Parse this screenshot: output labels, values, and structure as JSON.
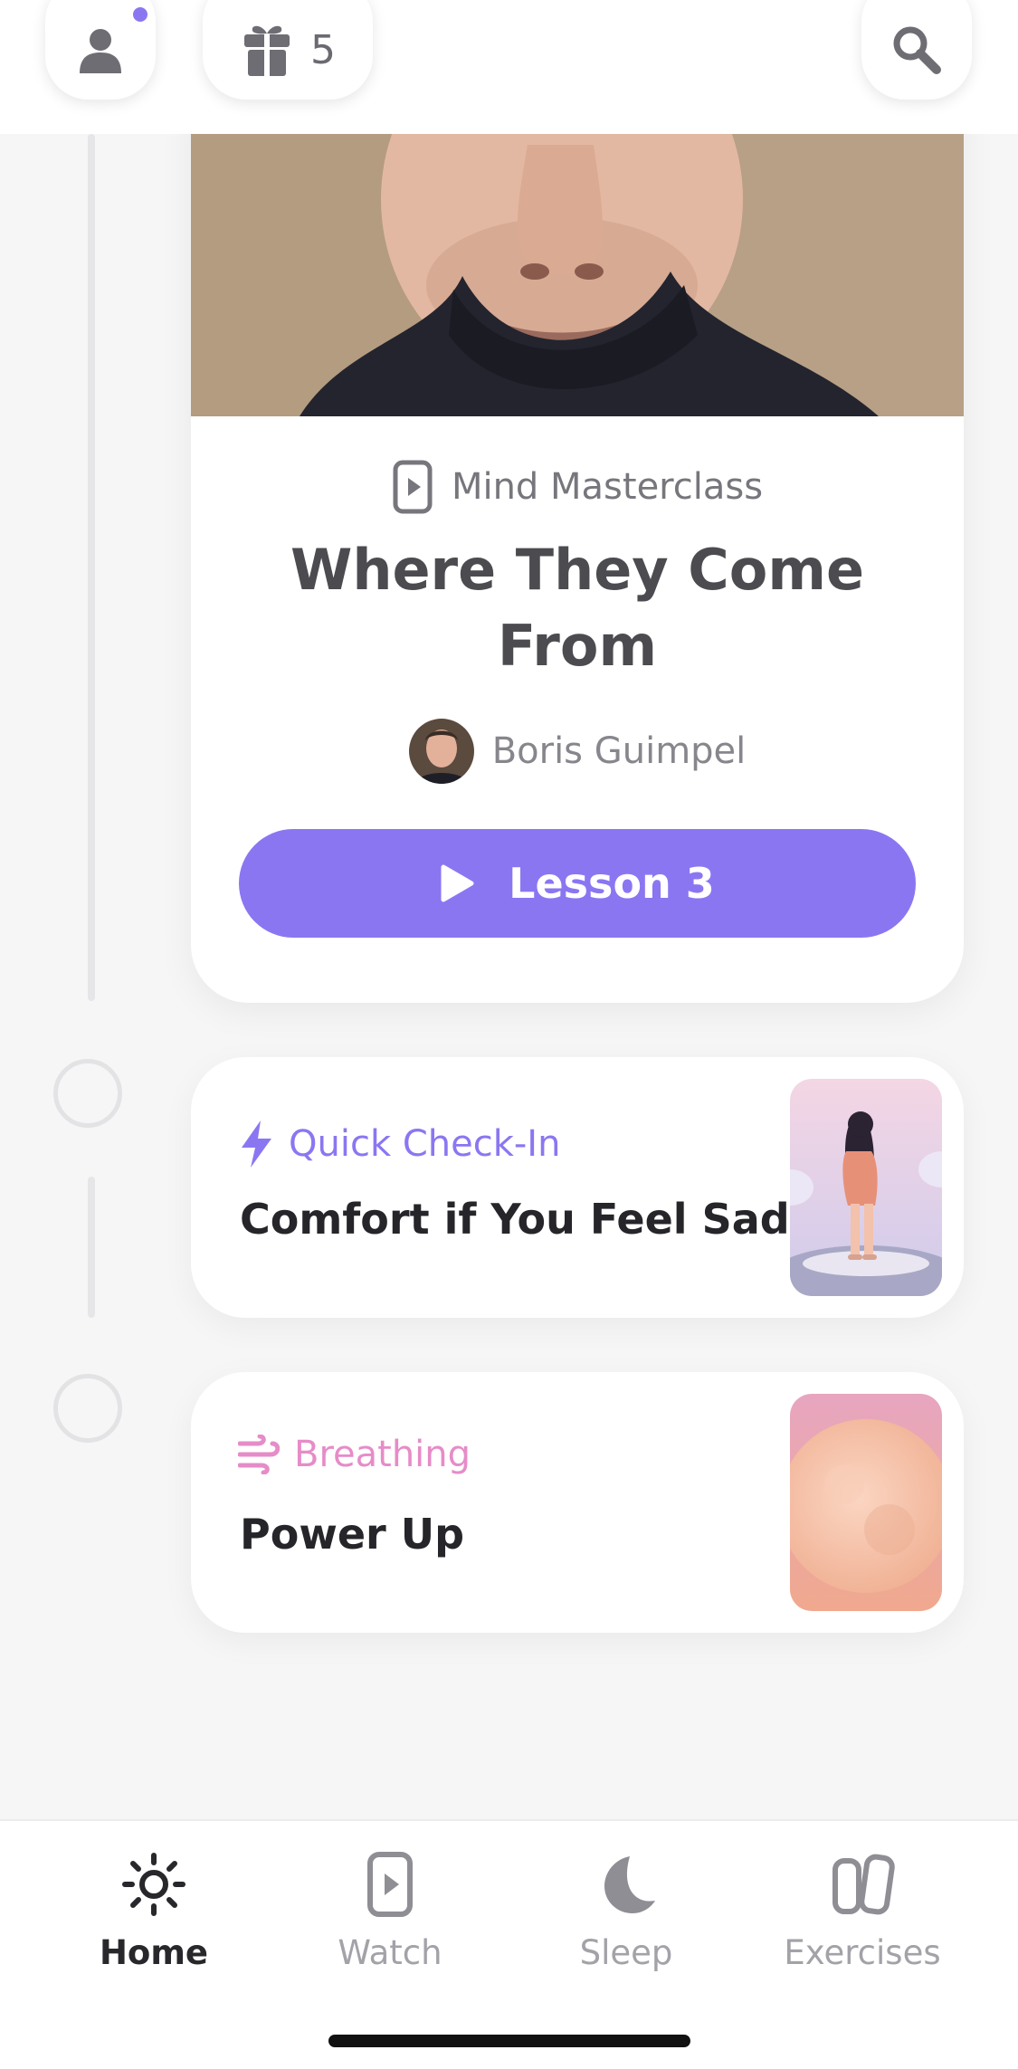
{
  "header": {
    "gift_count": "5",
    "has_notification": true
  },
  "feature": {
    "course_label": "Mind Masterclass",
    "lesson_title": "Where They Come From",
    "author": "Boris Guimpel",
    "button_label": "Lesson 3",
    "button_color": "#8b76f2"
  },
  "activities": [
    {
      "category": "Quick Check-In",
      "category_color": "#8b76f2",
      "icon": "lightning-icon",
      "title": "Comfort if You Feel Sad"
    },
    {
      "category": "Breathing",
      "category_color": "#e68cc8",
      "icon": "wind-icon",
      "title": "Power Up"
    }
  ],
  "nav": {
    "items": [
      {
        "label": "Home",
        "icon": "sun-icon",
        "active": true
      },
      {
        "label": "Watch",
        "icon": "play-card-icon",
        "active": false
      },
      {
        "label": "Sleep",
        "icon": "moon-icon",
        "active": false
      },
      {
        "label": "Exercises",
        "icon": "cards-icon",
        "active": false
      }
    ]
  }
}
